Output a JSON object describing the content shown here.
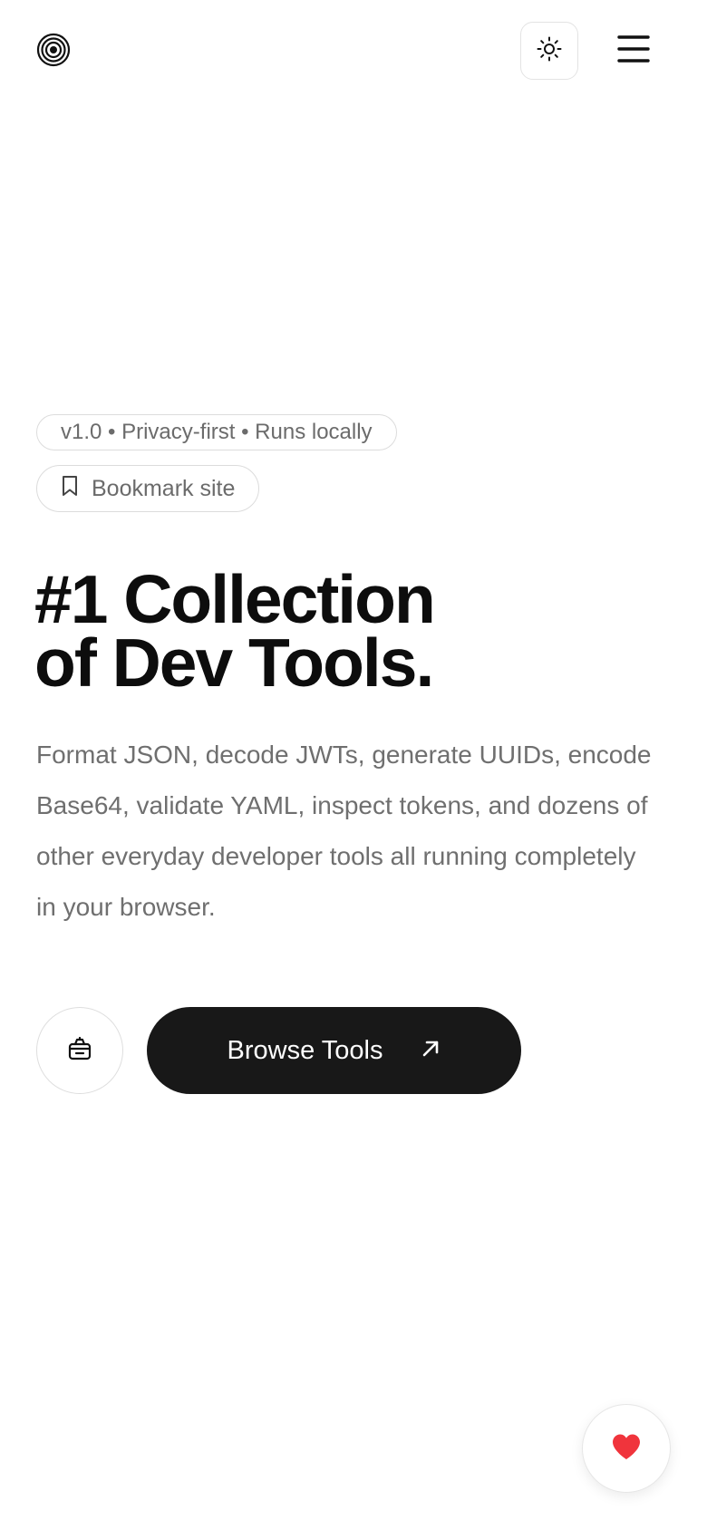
{
  "header": {
    "logo_icon": "concentric-circles-logo",
    "theme_toggle_icon": "sun-icon",
    "menu_icon": "hamburger-menu-icon"
  },
  "hero": {
    "version_pill": "v1.0 • Privacy-first • Runs locally",
    "bookmark_label": "Bookmark site",
    "bookmark_icon": "bookmark-icon",
    "headline_line1": "#1 Collection",
    "headline_line2": "of Dev Tools.",
    "description": "Format JSON, decode JWTs, generate UUIDs, encode Base64, validate YAML, inspect tokens, and dozens of other everyday developer tools all running completely in your browser.",
    "secondary_icon": "toolbox-icon",
    "browse_label": "Browse Tools",
    "browse_icon": "arrow-up-right-icon"
  },
  "floating": {
    "heart_icon": "heart-icon",
    "heart_color": "#f0343c"
  },
  "colors": {
    "primary_button": "#181818",
    "muted_text": "#6f6f6f",
    "border": "#dcdcdc"
  }
}
